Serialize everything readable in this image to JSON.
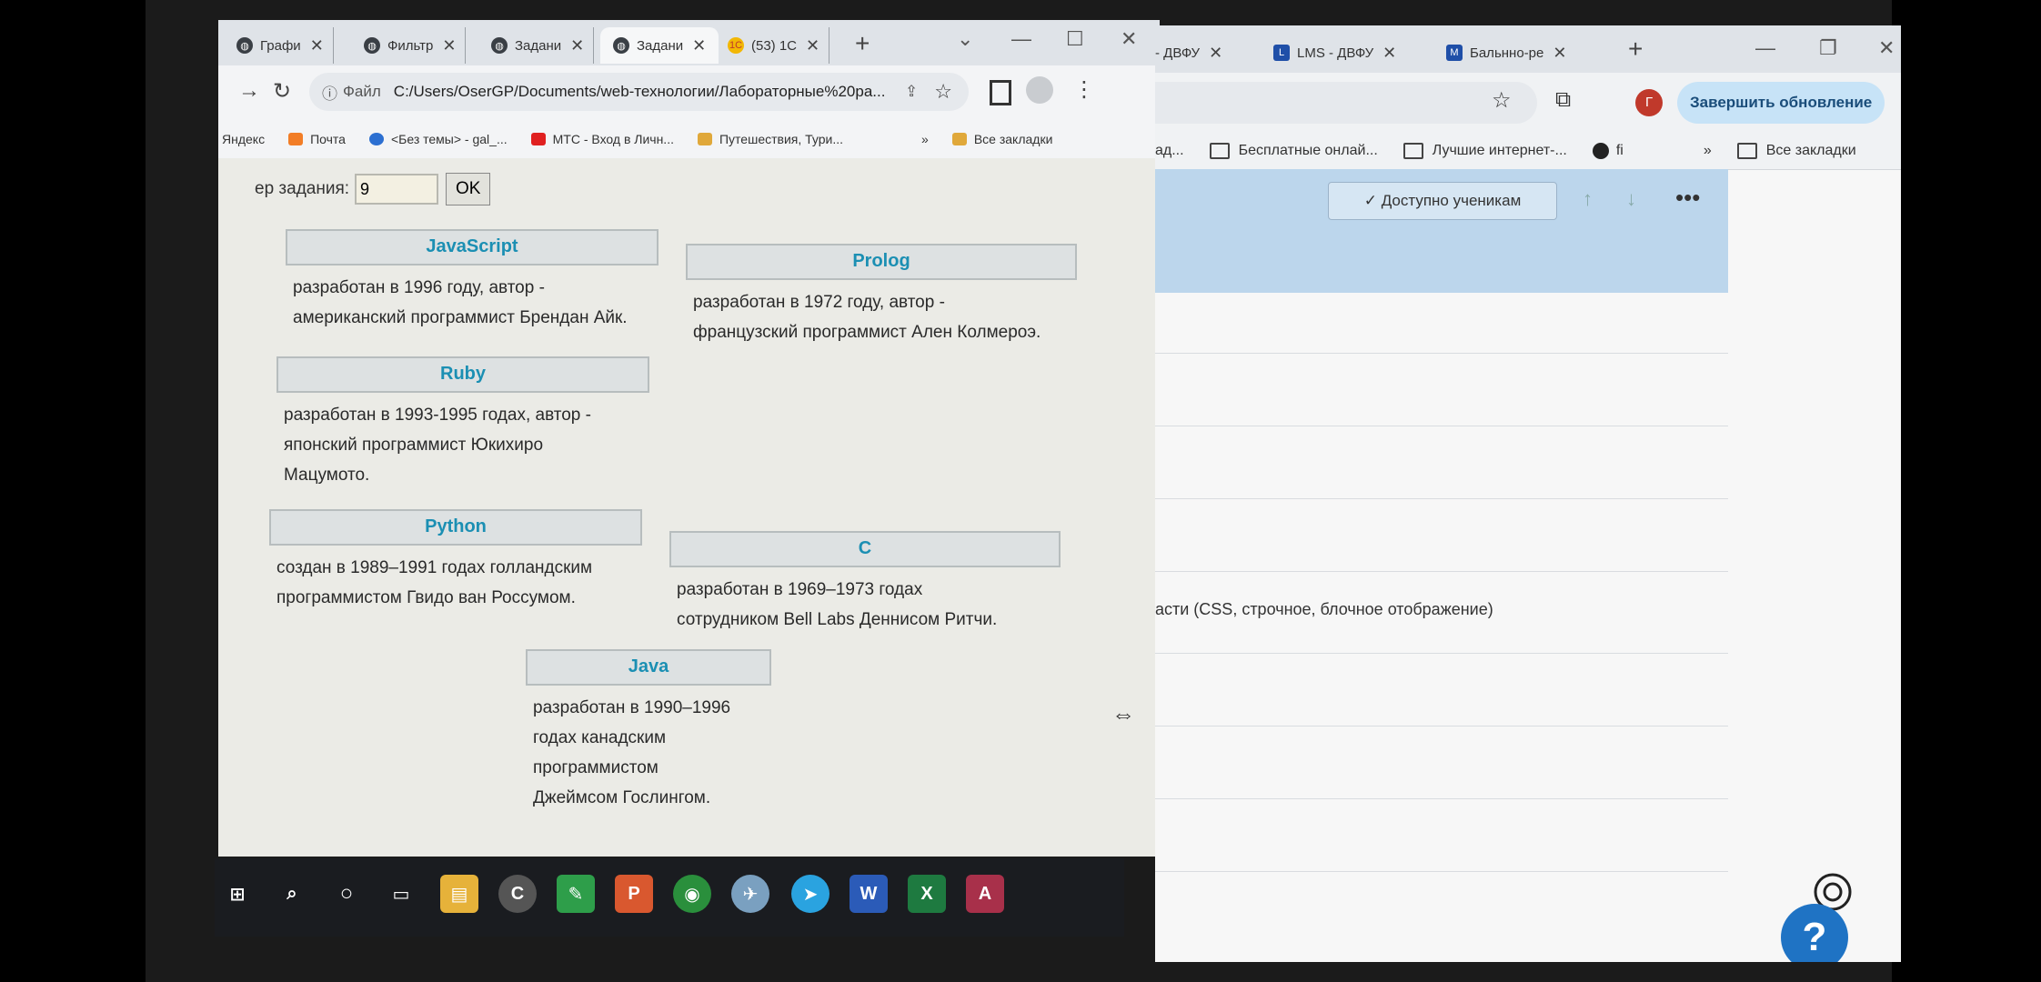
{
  "left_window": {
    "tabs": [
      {
        "label": "Графи",
        "icon": "globe-icon"
      },
      {
        "label": "Фильтр",
        "icon": "globe-icon"
      },
      {
        "label": "Задани",
        "icon": "globe-icon"
      },
      {
        "label": "Задани",
        "icon": "globe-icon",
        "active": true
      },
      {
        "label": "(53) 1С",
        "icon": "1c-icon"
      }
    ],
    "address": {
      "label": "Файл",
      "url": "C:/Users/OserGP/Documents/web-технологии/Лабораторные%20ра..."
    },
    "bookmarks": [
      "Яндекс",
      "Почта",
      "<Без темы> - gal_...",
      "МТС - Вход в Личн...",
      "Путешествия, Тури...",
      "»",
      "Все закладки"
    ],
    "page": {
      "task_label": "ер задания:",
      "task_value": "9",
      "ok_label": "OK",
      "cards": [
        {
          "title": "JavaScript",
          "text": [
            "разработан в 1996 году, автор -",
            "американский программист Брендан Айк."
          ]
        },
        {
          "title": "Prolog",
          "text": [
            "разработан в 1972 году, автор -",
            "французский программист Ален Колмероэ."
          ]
        },
        {
          "title": "Ruby",
          "text": [
            "разработан в 1993-1995 годах, автор -",
            "японский программист Юкихиро",
            "Мацумото."
          ]
        },
        {
          "title": "Python",
          "text": [
            "создан в 1989–1991 годах голландским",
            "программистом Гвидо ван Россумом."
          ]
        },
        {
          "title": "C",
          "text": [
            "разработан в 1969–1973 годах",
            "сотрудником Bell Labs Деннисом Ритчи."
          ]
        },
        {
          "title": "Java",
          "text": [
            "разработан в 1990–1996",
            "годах канадским",
            "программистом",
            "Джеймсом Гослингом."
          ]
        }
      ]
    }
  },
  "right_window": {
    "tabs": [
      {
        "label": "- ДВФУ"
      },
      {
        "label": "LMS - ДВФУ"
      },
      {
        "label": "Бальнно-ре"
      }
    ],
    "update_button": "Завершить обновление",
    "avatar_letter": "Г",
    "bookmarks": [
      "ад...",
      "Бесплатные онлай...",
      "Лучшие интернет-...",
      "fi",
      "»",
      "Все закладки"
    ],
    "available_label": "Доступно ученикам",
    "course_text": "асти (CSS, строчное, блочное отображение)"
  },
  "taskbar": {
    "apps": [
      "windows-start-icon",
      "search-icon",
      "cortana-icon",
      "task-view-icon",
      "file-explorer-icon",
      "c-app-icon",
      "notes-icon",
      "powerpoint-icon",
      "chrome-icon",
      "bird-app-icon",
      "telegram-icon",
      "word-icon",
      "excel-icon",
      "access-icon"
    ]
  }
}
